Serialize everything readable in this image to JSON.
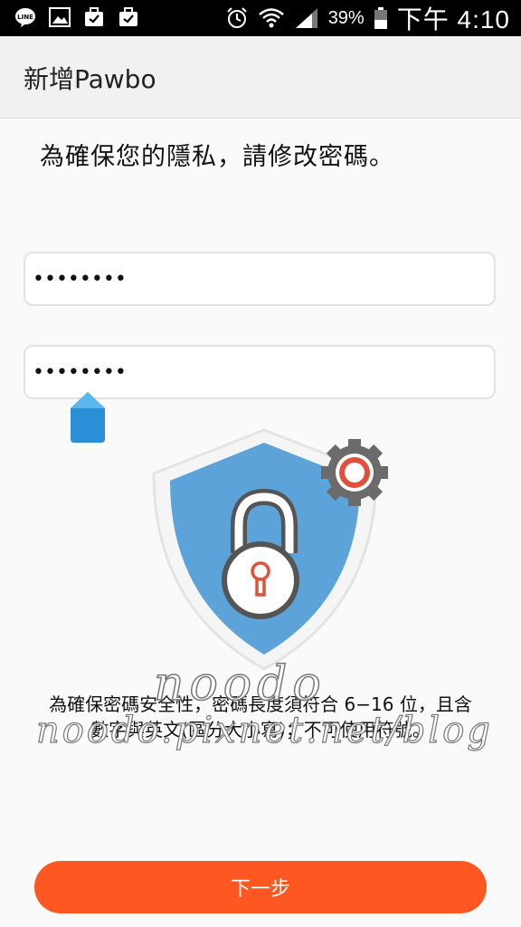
{
  "status_bar": {
    "icons_left": [
      "line-icon",
      "gallery-icon",
      "briefcase-icon",
      "briefcase-icon"
    ],
    "icons_right": [
      "alarm-icon",
      "wifi-icon",
      "signal-icon"
    ],
    "battery": "39%",
    "time": "下午 4:10"
  },
  "appbar": {
    "title": "新增Pawbo"
  },
  "main": {
    "headline": "為確保您的隱私，請修改密碼。",
    "password_value": "••••••••",
    "confirm_value": "••••••••",
    "info_line1": "為確保密碼安全性，密碼長度須符合 6−16 位，且含",
    "info_line2": "數字與英文(區分大小寫)；不可使用符號。",
    "next_label": "下一步"
  },
  "watermark": {
    "line1": "noodo",
    "line2": "noodo.pixnet.net/blog"
  },
  "colors": {
    "accent": "#ff5722",
    "shield": "#5ba3d8",
    "handle": "#2a8fd6",
    "lock_keyhole": "#e0503a"
  }
}
